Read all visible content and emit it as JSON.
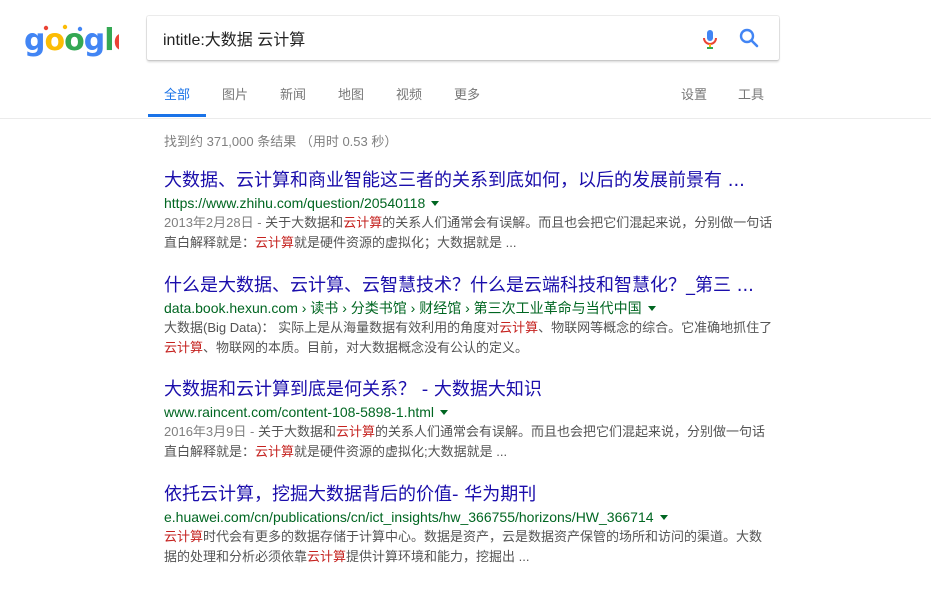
{
  "search": {
    "query": "intitle:大数据 云计算",
    "logo_text": "google"
  },
  "tabs": [
    {
      "label": "全部"
    },
    {
      "label": "图片"
    },
    {
      "label": "新闻"
    },
    {
      "label": "地图"
    },
    {
      "label": "视频"
    },
    {
      "label": "更多"
    }
  ],
  "tools": {
    "settings": "设置",
    "tools": "工具"
  },
  "stats": "找到约 371,000 条结果 （用时 0.53 秒）",
  "results": [
    {
      "title": "大数据、云计算和商业智能这三者的关系到底如何，以后的发展前景有 ...",
      "url": "https://www.zhihu.com/question/20540118",
      "snippet": [
        {
          "t": "2013年2月28日 - ",
          "c": "date"
        },
        {
          "t": "关于大数据和",
          "c": ""
        },
        {
          "t": "云计算",
          "c": "hl"
        },
        {
          "t": "的关系人们通常会有误解。而且也会把它们混起来说，分别做一句话直白解释就是：",
          "c": ""
        },
        {
          "t": "云计算",
          "c": "hl"
        },
        {
          "t": "就是硬件资源的虚拟化；大数据就是 ...",
          "c": ""
        }
      ]
    },
    {
      "title": "什么是大数据、云计算、云智慧技术？什么是云端科技和智慧化？_第三 ...",
      "url": "data.book.hexun.com › 读书 › 分类书馆 › 财经馆 › 第三次工业革命与当代中国",
      "snippet": [
        {
          "t": "大数据(Big Data)： 实际上是从海量数据有效利用的角度对",
          "c": ""
        },
        {
          "t": "云计算",
          "c": "hl"
        },
        {
          "t": "、物联网等概念的综合。它准确地抓住了",
          "c": ""
        },
        {
          "t": "云计算",
          "c": "hl"
        },
        {
          "t": "、物联网的本质。目前，对大数据概念没有公认的定义。",
          "c": ""
        }
      ]
    },
    {
      "title": "大数据和云计算到底是何关系？ - 大数据大知识",
      "url": "www.raincent.com/content-108-5898-1.html",
      "snippet": [
        {
          "t": "2016年3月9日 - ",
          "c": "date"
        },
        {
          "t": "关于大数据和",
          "c": ""
        },
        {
          "t": "云计算",
          "c": "hl"
        },
        {
          "t": "的关系人们通常会有误解。而且也会把它们混起来说，分别做一句话直白解释就是：",
          "c": ""
        },
        {
          "t": "云计算",
          "c": "hl"
        },
        {
          "t": "就是硬件资源的虚拟化;大数据就是 ...",
          "c": ""
        }
      ]
    },
    {
      "title": "依托云计算，挖掘大数据背后的价值- 华为期刊",
      "url": "e.huawei.com/cn/publications/cn/ict_insights/hw_366755/horizons/HW_366714",
      "snippet": [
        {
          "t": "云计算",
          "c": "hl"
        },
        {
          "t": "时代会有更多的数据存储于计算中心。数据是资产，云是数据资产保管的场所和访问的渠道。大数据的处理和分析必须依靠",
          "c": ""
        },
        {
          "t": "云计算",
          "c": "hl"
        },
        {
          "t": "提供计算环境和能力，挖掘出 ...",
          "c": ""
        }
      ]
    }
  ],
  "colors": {
    "title": "#1a0dab",
    "url": "#006621",
    "highlight": "#c5221f",
    "active_tab": "#1a73e8"
  }
}
